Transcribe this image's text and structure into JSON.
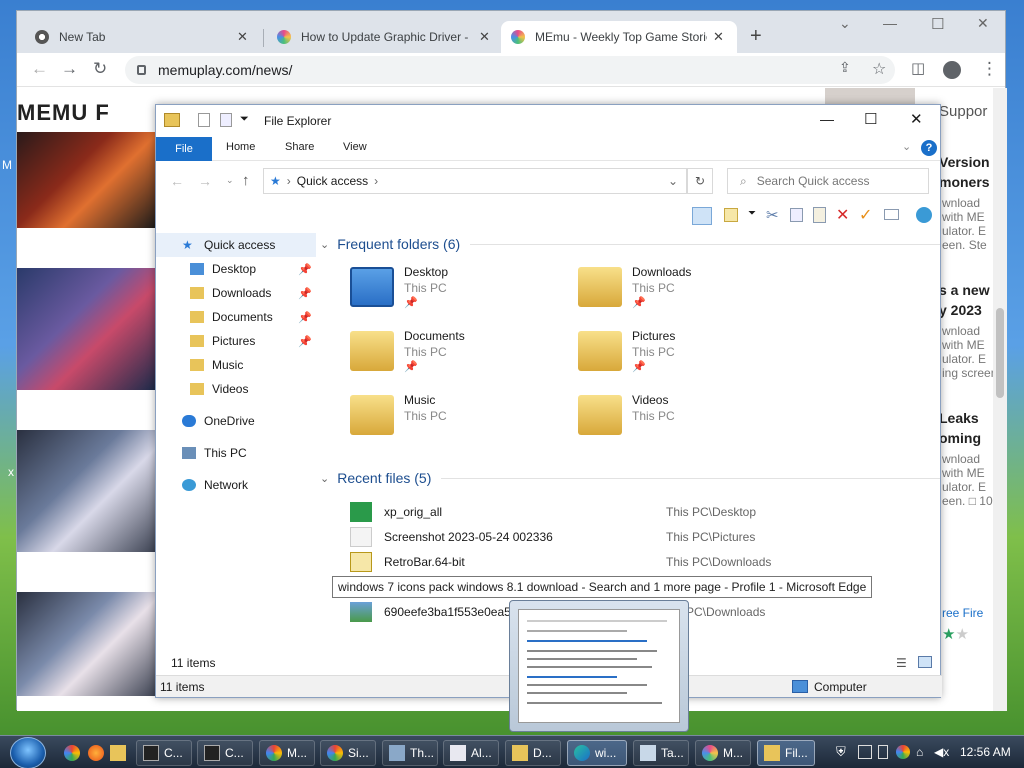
{
  "chrome": {
    "tabs": [
      {
        "title": "New Tab"
      },
      {
        "title": "How to Update Graphic Driver -"
      },
      {
        "title": "MEmu - Weekly Top Game Stories"
      }
    ],
    "new_tab": "+",
    "url": "memuplay.com/news/",
    "logo": "MEMU F",
    "right_col": [
      {
        "head": "Suppor"
      },
      {
        "head": "Version",
        "head2": "moners",
        "sub": "wnload",
        "sub2": "with ME",
        "sub3": "ulator. E",
        "sub4": "een. Ste"
      },
      {
        "head": "s a new",
        "head2": "y 2023",
        "sub": "wnload",
        "sub2": "with ME",
        "sub3": "ulator. E",
        "sub4": "ing screen."
      },
      {
        "head": "Leaks",
        "head2": "oming",
        "sub": "wnload",
        "sub2": "with ME",
        "sub3": "ulator. E",
        "sub4": "een. □ 10"
      },
      {
        "link": "ree Fire"
      }
    ]
  },
  "explorer": {
    "title": "File Explorer",
    "ribbon": {
      "file": "File",
      "home": "Home",
      "share": "Share",
      "view": "View"
    },
    "address": "Quick access",
    "search_placeholder": "Search Quick access",
    "nav": [
      {
        "label": "Quick access",
        "pinned": false,
        "color": "#2a7ad6"
      },
      {
        "label": "Desktop",
        "pinned": true,
        "color": "#4a8fd8"
      },
      {
        "label": "Downloads",
        "pinned": true,
        "color": "#e8c45a"
      },
      {
        "label": "Documents",
        "pinned": true,
        "color": "#e8c45a"
      },
      {
        "label": "Pictures",
        "pinned": true,
        "color": "#e8c45a"
      },
      {
        "label": "Music",
        "pinned": false,
        "color": "#e8c45a"
      },
      {
        "label": "Videos",
        "pinned": false,
        "color": "#e8c45a"
      },
      {
        "label": "OneDrive",
        "pinned": false,
        "color": "#2a7ad6"
      },
      {
        "label": "This PC",
        "pinned": false,
        "color": "#6a8fb8"
      },
      {
        "label": "Network",
        "pinned": false,
        "color": "#3a9ad6"
      }
    ],
    "frequent_header": "Frequent folders (6)",
    "folders": [
      {
        "name": "Desktop",
        "loc": "This PC",
        "pinned": true
      },
      {
        "name": "Downloads",
        "loc": "This PC",
        "pinned": true
      },
      {
        "name": "Documents",
        "loc": "This PC",
        "pinned": true
      },
      {
        "name": "Pictures",
        "loc": "This PC",
        "pinned": true
      },
      {
        "name": "Music",
        "loc": "This PC",
        "pinned": false
      },
      {
        "name": "Videos",
        "loc": "This PC",
        "pinned": false
      }
    ],
    "recent_header": "Recent files (5)",
    "recent": [
      {
        "name": "xp_orig_all",
        "path": "This PC\\Desktop"
      },
      {
        "name": "Screenshot 2023-05-24 002336",
        "path": "This PC\\Pictures"
      },
      {
        "name": "RetroBar.64-bit",
        "path": "This PC\\Downloads"
      },
      {
        "name": "690eefe3ba1f553e0ea527",
        "path": "PC\\Downloads"
      }
    ],
    "items_count": "11 items",
    "status_items": "11 items",
    "status_location": "Computer"
  },
  "tooltip": "windows 7 icons pack windows 8.1 download - Search and 1 more page - Profile 1 - Microsoft Edge",
  "taskbar": {
    "buttons": [
      "C...",
      "C...",
      "M...",
      "Si...",
      "Th...",
      "Al...",
      "D...",
      "wi...",
      "Ta...",
      "M...",
      "Fil..."
    ],
    "time": "12:56 AM"
  }
}
